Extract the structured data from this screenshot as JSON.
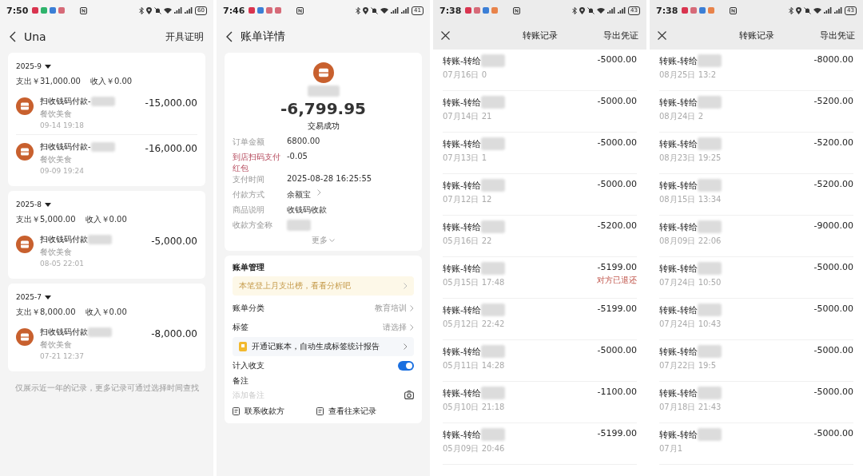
{
  "panels": [
    {
      "kind": "bill_list",
      "status": {
        "time": "7:50",
        "apps": [
          {
            "color": "#d9344f"
          },
          {
            "color": "#2fb36b"
          },
          {
            "color": "#3b7fd6"
          },
          {
            "color": "#d66a78"
          }
        ],
        "battery": "60"
      },
      "header": {
        "title": "Una",
        "action": "开具证明"
      },
      "months": [
        {
          "month": "2025-9",
          "expense": "支出￥31,000.00",
          "income": "收入￥0.00",
          "items": [
            {
              "title": "扫收钱码付款-",
              "category": "餐饮美食",
              "time": "09-14 19:18",
              "amount": "-15,000.00"
            },
            {
              "title": "扫收钱码付款-",
              "category": "餐饮美食",
              "time": "09-09 19:24",
              "amount": "-16,000.00"
            }
          ]
        },
        {
          "month": "2025-8",
          "expense": "支出￥5,000.00",
          "income": "收入￥0.00",
          "items": [
            {
              "title": "扫收钱码付款",
              "category": "餐饮美食",
              "time": "08-05 22:01",
              "amount": "-5,000.00"
            }
          ]
        },
        {
          "month": "2025-7",
          "expense": "支出￥8,000.00",
          "income": "收入￥0.00",
          "items": [
            {
              "title": "扫收钱码付款",
              "category": "餐饮美食",
              "time": "07-21 12:37",
              "amount": "-8,000.00"
            }
          ]
        }
      ],
      "footer": "仅展示近一年的记录，更多记录可通过选择时间查找"
    },
    {
      "kind": "bill_detail",
      "status": {
        "time": "7:46",
        "apps": [
          {
            "color": "#d9344f"
          },
          {
            "color": "#3b7fd6"
          },
          {
            "color": "#d66a78"
          },
          {
            "color": "#d66a78"
          }
        ],
        "battery": "41"
      },
      "header": {
        "title": "账单详情"
      },
      "amount": "-6,799.95",
      "result": "交易成功",
      "fields": [
        {
          "label": "订单金额",
          "value": "6800.00",
          "emphasis": false,
          "link": false
        },
        {
          "label": "到店扫码支付红包",
          "value": "-0.05",
          "emphasis": true,
          "link": false
        },
        {
          "label": "支付时间",
          "value": "2025-08-28 16:25:55",
          "emphasis": false,
          "link": false
        },
        {
          "label": "付款方式",
          "value": "余额宝",
          "emphasis": false,
          "link": true
        },
        {
          "label": "商品说明",
          "value": "收钱码收款",
          "emphasis": false,
          "link": false
        },
        {
          "label": "收款方全称",
          "emphasis": false,
          "link": false
        }
      ],
      "more": "更多",
      "manage": {
        "title": "账单管理",
        "banner": "本笔登上月支出榜，看看分析吧",
        "rows": [
          {
            "label": "账单分类",
            "value": "教育培训"
          },
          {
            "label": "标签",
            "value": "请选择"
          }
        ],
        "promo": "开通记账本，自动生成标签统计报告",
        "toggle": {
          "label": "计入收支",
          "on": true
        },
        "note": {
          "label": "备注",
          "placeholder": "添加备注"
        },
        "actions": [
          "联系收款方",
          "查看往来记录"
        ]
      }
    },
    {
      "kind": "transfers",
      "status": {
        "time": "7:38",
        "apps": [
          {
            "color": "#d9344f"
          },
          {
            "color": "#d66a78"
          },
          {
            "color": "#3b7fd6"
          },
          {
            "color": "#e8834a"
          }
        ],
        "battery": "43"
      },
      "header": {
        "title": "转账记录",
        "action": "导出凭证"
      },
      "rows": [
        {
          "title": "转账-转给",
          "date": "07月16日 0",
          "amount": "-5000.00"
        },
        {
          "title": "转账-转给",
          "date": "07月14日 21",
          "amount": "-5000.00"
        },
        {
          "title": "转账-转给",
          "date": "07月13日 1",
          "amount": "-5000.00"
        },
        {
          "title": "转账-转给",
          "date": "07月12日 12",
          "amount": "-5000.00"
        },
        {
          "title": "转账-转给",
          "date": "05月16日 22",
          "amount": "-5200.00"
        },
        {
          "title": "转账-转给",
          "date": "05月15日 17:48",
          "amount": "-5199.00",
          "note": "对方已退还"
        },
        {
          "title": "转账-转给",
          "date": "05月12日 22:42",
          "amount": "-5199.00"
        },
        {
          "title": "转账-转给",
          "date": "05月11日 14:28",
          "amount": "-5000.00"
        },
        {
          "title": "转账-转给",
          "date": "05月10日 21:18",
          "amount": "-1100.00"
        },
        {
          "title": "转账-转给",
          "date": "05月09日 20:46",
          "amount": "-5199.00"
        }
      ]
    },
    {
      "kind": "transfers",
      "status": {
        "time": "7:38",
        "apps": [
          {
            "color": "#d9344f"
          },
          {
            "color": "#d66a78"
          },
          {
            "color": "#3b7fd6"
          },
          {
            "color": "#e8834a"
          }
        ],
        "battery": "43"
      },
      "header": {
        "title": "转账记录",
        "action": "导出凭证"
      },
      "rows": [
        {
          "title": "转账-转给",
          "date": "08月25日 13:2",
          "amount": "-8000.00"
        },
        {
          "title": "转账-转给",
          "date": "08月24日 2",
          "amount": "-5200.00"
        },
        {
          "title": "转账-转给",
          "date": "08月23日 19:25",
          "amount": "-5200.00"
        },
        {
          "title": "转账-转给",
          "date": "08月15日 13:34",
          "amount": "-5200.00"
        },
        {
          "title": "转账-转给",
          "date": "08月09日 22:06",
          "amount": "-9000.00"
        },
        {
          "title": "转账-转给",
          "date": "07月24日 10:50",
          "amount": "-5000.00"
        },
        {
          "title": "转账-转给",
          "date": "07月24日 10:43",
          "amount": "-5000.00"
        },
        {
          "title": "转账-转给",
          "date": "07月22日 19:5",
          "amount": "-5000.00"
        },
        {
          "title": "转账-转给",
          "date": "07月18日 21:43",
          "amount": "-5000.00"
        },
        {
          "title": "转账-转给",
          "date": "07月1",
          "amount": "-5000.00"
        }
      ]
    }
  ]
}
